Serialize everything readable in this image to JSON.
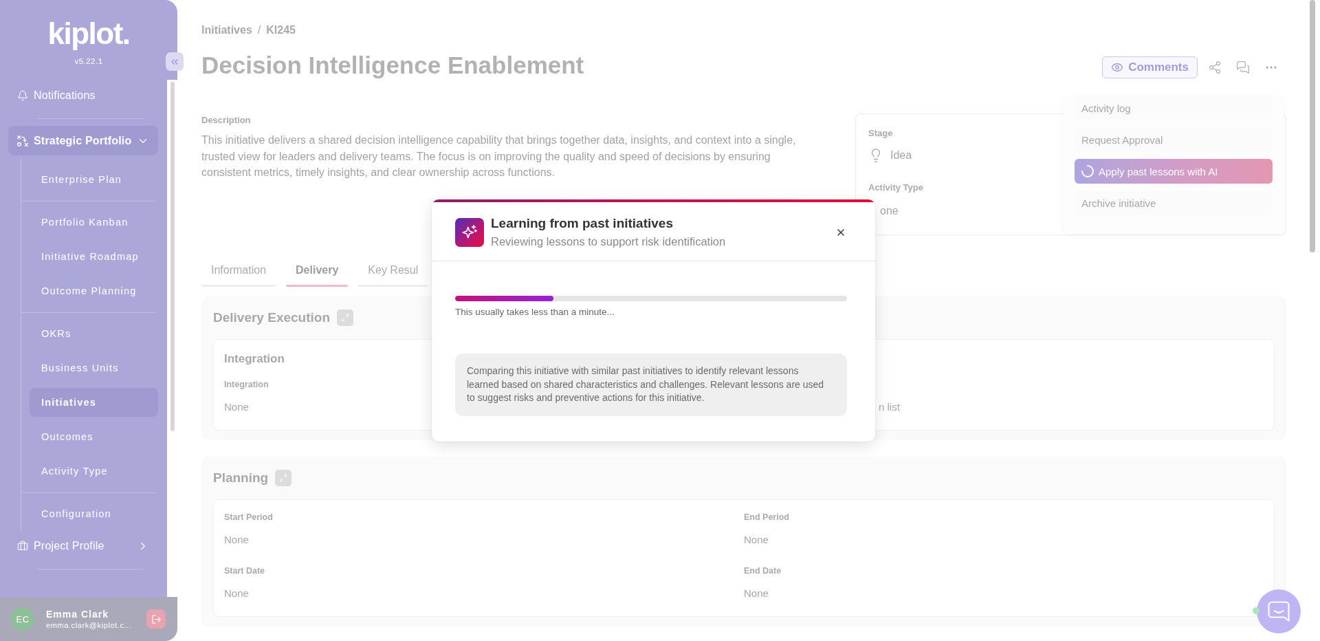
{
  "sidebar": {
    "logo": "kiplot.",
    "version": "v5.22.1",
    "items": [
      {
        "label": "Notifications",
        "kind": "link",
        "selected": false,
        "divider_after": true
      },
      {
        "label": "Strategic Portfolio",
        "kind": "group",
        "selected": true,
        "expanded": true,
        "divider_after": false,
        "children": [
          {
            "label": "Enterprise Plan",
            "selected": false,
            "divider_after": true
          },
          {
            "label": "Portfolio Kanban",
            "selected": false,
            "divider_after": false
          },
          {
            "label": "Initiative Roadmap",
            "selected": false,
            "divider_after": false
          },
          {
            "label": "Outcome Planning",
            "selected": false,
            "divider_after": true
          },
          {
            "label": "OKRs",
            "selected": false,
            "divider_after": false
          },
          {
            "label": "Business Units",
            "selected": false,
            "divider_after": false
          },
          {
            "label": "Initiatives",
            "selected": true,
            "divider_after": false
          },
          {
            "label": "Outcomes",
            "selected": false,
            "divider_after": false
          },
          {
            "label": "Activity Type",
            "selected": false,
            "divider_after": true
          },
          {
            "label": "Configuration",
            "selected": false,
            "divider_after": false
          }
        ]
      },
      {
        "label": "Project Profile",
        "kind": "group",
        "selected": false,
        "expanded": false,
        "divider_after": true
      }
    ],
    "user": {
      "initials": "EC",
      "name": "Emma Clark",
      "email": "emma.clark@kiplot.c..."
    }
  },
  "breadcrumb": {
    "items": [
      "Initiatives",
      "KI245"
    ],
    "separator": "/"
  },
  "title": "Decision Intelligence Enablement",
  "actions": {
    "comments": "Comments"
  },
  "menu": {
    "items": [
      {
        "label": "Activity log",
        "selected": false,
        "loading": false
      },
      {
        "label": "Request Approval",
        "selected": false,
        "loading": false
      },
      {
        "label": "Apply past lessons with AI",
        "selected": true,
        "loading": true
      },
      {
        "label": "Archive initiative",
        "selected": false,
        "loading": false
      }
    ]
  },
  "description": {
    "label": "Description",
    "text": "This initiative delivers a shared decision intelligence capability that brings together data, insights, and context into a single, trusted view for leaders and delivery teams. The focus is on improving the quality and speed of decisions by ensuring consistent metrics, timely insights, and clear ownership across functions."
  },
  "summary_card": {
    "fields": [
      {
        "label": "Stage",
        "value": "Idea",
        "kind": "stage"
      },
      {
        "label": "Activity Type",
        "value": "one",
        "kind": "plain"
      }
    ]
  },
  "tabs": [
    {
      "label": "Information",
      "selected": false
    },
    {
      "label": "Delivery",
      "selected": true
    },
    {
      "label": "Key Resul",
      "selected": false
    }
  ],
  "sections": [
    {
      "title": "Delivery Execution",
      "kind": "integration",
      "card_title": "Integration",
      "fields": [
        {
          "label": "Integration",
          "value": "None"
        },
        {
          "value": "n list"
        }
      ]
    },
    {
      "title": "Planning",
      "kind": "planning",
      "fields": [
        {
          "label": "Start Period",
          "value": "None"
        },
        {
          "label": "End Period",
          "value": "None"
        },
        {
          "label": "Start Date",
          "value": "None"
        },
        {
          "label": "End Date",
          "value": "None"
        }
      ]
    }
  ],
  "dialog": {
    "title": "Learning from past initiatives",
    "subtitle": "Reviewing lessons to support risk identification",
    "progress": {
      "level": 0.25
    },
    "caption": "This usually takes less than a minute...",
    "info": "Comparing this initiative with similar past initiatives to identify relevant lessons learned based on shared characteristics and challenges. Relevant lessons are used to suggest risks and preventive actions for this initiative."
  }
}
